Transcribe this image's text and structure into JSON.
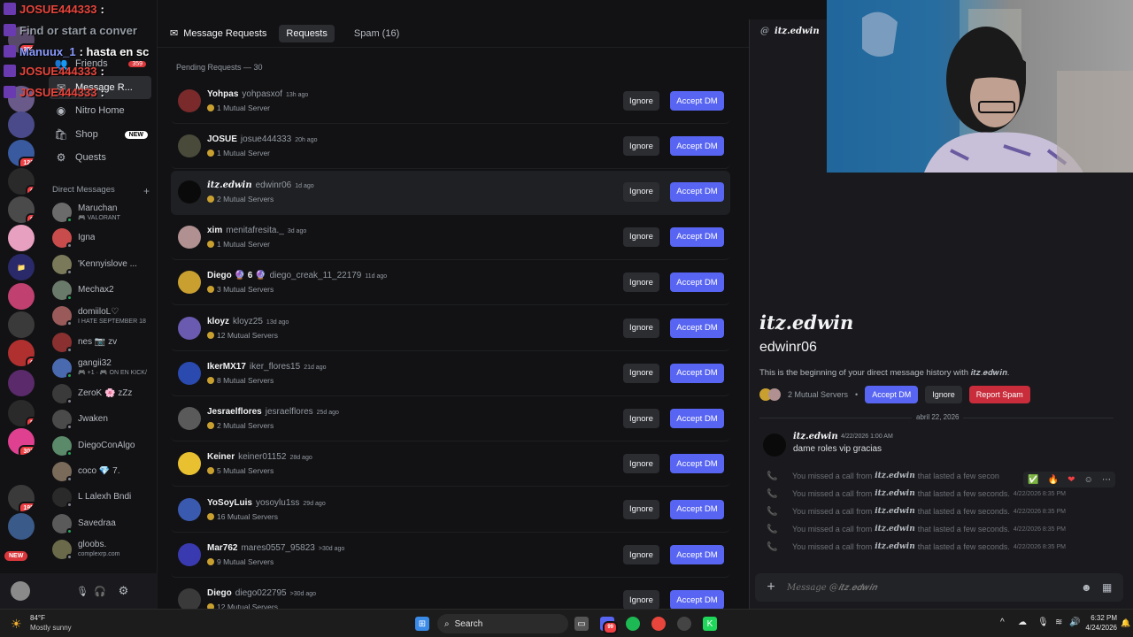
{
  "chat_overlay": [
    {
      "user": "JOSUE444333",
      "text": ":",
      "color": "#e8453c"
    },
    {
      "user": "Find or start a conver",
      "text": "",
      "color": "#949ba4"
    },
    {
      "user": "Manuux_1",
      "text": ": hasta en sc",
      "color": "#8a9bff"
    },
    {
      "user": "JOSUE444333",
      "text": ":",
      "color": "#e8453c"
    },
    {
      "user": "JOSUE444333",
      "text": ":",
      "color": "#e8453c"
    }
  ],
  "rail_badges": [
    "359",
    "123",
    "6",
    "9",
    "6",
    "8",
    "5",
    "303",
    "195"
  ],
  "rail_new": "NEW",
  "nav": {
    "friends": "Friends",
    "friends_badge": "359",
    "message_requests": "Message R...",
    "nitro": "Nitro Home",
    "shop": "Shop",
    "shop_badge": "NEW",
    "quests": "Quests"
  },
  "dm_header": "Direct Messages",
  "dm_plus": "+",
  "dms": [
    {
      "name": "Maruchan",
      "sub": "🎮 VALORANT",
      "color": "#6b6b6b"
    },
    {
      "name": "Igna",
      "sub": "",
      "color": "#c94c4c"
    },
    {
      "name": "'Kennyislove ...",
      "sub": "",
      "color": "#7a7a5a"
    },
    {
      "name": "Mechax2",
      "sub": "",
      "color": "#6a7a6a"
    },
    {
      "name": "domiiloL♡",
      "sub": "I HATE SEPTEMBER 18",
      "color": "#9a5a5a"
    },
    {
      "name": "nes 📷 zv",
      "sub": "",
      "color": "#8a3030"
    },
    {
      "name": "gangii32",
      "sub": "🎮 +1 · 🎮 ON EN KICK/",
      "color": "#4a6ab0"
    },
    {
      "name": "ZeroK 🌸 zZz",
      "sub": "",
      "color": "#3a3a3a"
    },
    {
      "name": "Jwaken",
      "sub": "",
      "color": "#4a4a4a"
    },
    {
      "name": "DiegoConAlgo",
      "sub": "",
      "color": "#5a8a6a"
    },
    {
      "name": "coco 💎 7.",
      "sub": "",
      "color": "#7a6a5a"
    },
    {
      "name": "L Lalexh  Bndi",
      "sub": "",
      "color": "#2a2a2a"
    },
    {
      "name": "Savedraa",
      "sub": "",
      "color": "#5a5a5a"
    },
    {
      "name": "gloobs.",
      "sub": "complexrp.com",
      "color": "#6a6a4a"
    }
  ],
  "header": {
    "title": "Message Requests",
    "tab_requests": "Requests",
    "tab_spam": "Spam (16)"
  },
  "pending_label": "Pending Requests — 30",
  "buttons": {
    "ignore": "Ignore",
    "accept": "Accept DM"
  },
  "requests": [
    {
      "name": "Yohpas",
      "user": "yohpasxof",
      "time": "13h ago",
      "servers": "1 Mutual Server",
      "color": "#7a2a2a"
    },
    {
      "name": "JOSUE",
      "user": "josue444333",
      "time": "20h ago",
      "servers": "1 Mutual Server",
      "color": "#4a4a3a"
    },
    {
      "name": "𝒊𝒕𝒛.𝒆𝒅𝒘𝒊𝒏",
      "user": "edwinr06",
      "time": "1d ago",
      "servers": "2 Mutual Servers",
      "color": "#0a0a0a"
    },
    {
      "name": "xim",
      "user": "menitafresita._",
      "time": "3d ago",
      "servers": "1 Mutual Server",
      "color": "#b09090"
    },
    {
      "name": "Diego 🔮 6 🔮",
      "user": "diego_creak_11_22179",
      "time": "11d ago",
      "servers": "3 Mutual Servers",
      "color": "#c9a030"
    },
    {
      "name": "kloyz",
      "user": "kloyz25",
      "time": "13d ago",
      "servers": "12 Mutual Servers",
      "color": "#6a5ab0"
    },
    {
      "name": "IkerMX17",
      "user": "iker_flores15",
      "time": "21d ago",
      "servers": "8 Mutual Servers",
      "color": "#2a4ab0"
    },
    {
      "name": "Jesraelflores",
      "user": "jesraelflores",
      "time": "25d ago",
      "servers": "2 Mutual Servers",
      "color": "#5a5a5a"
    },
    {
      "name": "Keiner",
      "user": "keiner01152",
      "time": "28d ago",
      "servers": "5 Mutual Servers",
      "color": "#e8c030"
    },
    {
      "name": "YoSoyLuis",
      "user": "yosoylu1ss",
      "time": "29d ago",
      "servers": "16 Mutual Servers",
      "color": "#3a5ab0"
    },
    {
      "name": "Mar762",
      "user": "mares0557_95823",
      "time": ">30d ago",
      "servers": "9 Mutual Servers",
      "color": "#3a3ab0"
    },
    {
      "name": "Diego",
      "user": "diego022795",
      "time": ">30d ago",
      "servers": "12 Mutual Servers",
      "color": "#3a3a3a"
    }
  ],
  "right_pane": {
    "header_name": "𝒊𝒕𝒛.𝒆𝒅𝒘𝒊𝒏",
    "title": "itz.edwin",
    "username": "edwinr06",
    "begin_text": "This is the beginning of your direct message history with 𝒊𝒕𝒛.𝒆𝒅𝒘𝒊𝒏.",
    "mutual": "2 Mutual Servers",
    "accept": "Accept DM",
    "ignore": "Ignore",
    "report": "Report Spam",
    "date_divider": "abril 22, 2026",
    "message": {
      "author": "𝒊𝒕𝒛.𝒆𝒅𝒘𝒊𝒏",
      "time": "4/22/2026 1:00 AM",
      "text": "dame roles vip gracias"
    },
    "calls": [
      {
        "pre": "You missed a call from",
        "name": "𝒊𝒕𝒛.𝒆𝒅𝒘𝒊𝒏",
        "post": "that lasted a few secon",
        "time": ""
      },
      {
        "pre": "You missed a call from",
        "name": "𝒊𝒕𝒛.𝒆𝒅𝒘𝒊𝒏",
        "post": "that lasted a few seconds.",
        "time": "4/22/2026 8:35 PM"
      },
      {
        "pre": "You missed a call from",
        "name": "𝒊𝒕𝒛.𝒆𝒅𝒘𝒊𝒏",
        "post": "that lasted a few seconds.",
        "time": "4/22/2026 8:35 PM"
      },
      {
        "pre": "You missed a call from",
        "name": "𝒊𝒕𝒛.𝒆𝒅𝒘𝒊𝒏",
        "post": "that lasted a few seconds.",
        "time": "4/22/2026 8:35 PM"
      },
      {
        "pre": "You missed a call from",
        "name": "𝒊𝒕𝒛.𝒆𝒅𝒘𝒊𝒏",
        "post": "that lasted a few seconds.",
        "time": "4/22/2026 8:35 PM"
      }
    ],
    "reactions": [
      "✅",
      "🔥",
      "❤",
      "☺",
      "⋯"
    ],
    "composer_placeholder": "Message @𝒊𝒕𝒛.𝒆𝒅𝒘𝒊𝒏"
  },
  "taskbar": {
    "temp": "84°F",
    "weather": "Mostly sunny",
    "search": "Search",
    "time": "6:32 PM",
    "date": "4/24/2026",
    "discord_badge": "99"
  },
  "colors": {
    "accent": "#5865f2",
    "danger": "#da373c",
    "bg": "#121214",
    "panel": "#1a1a1e"
  }
}
